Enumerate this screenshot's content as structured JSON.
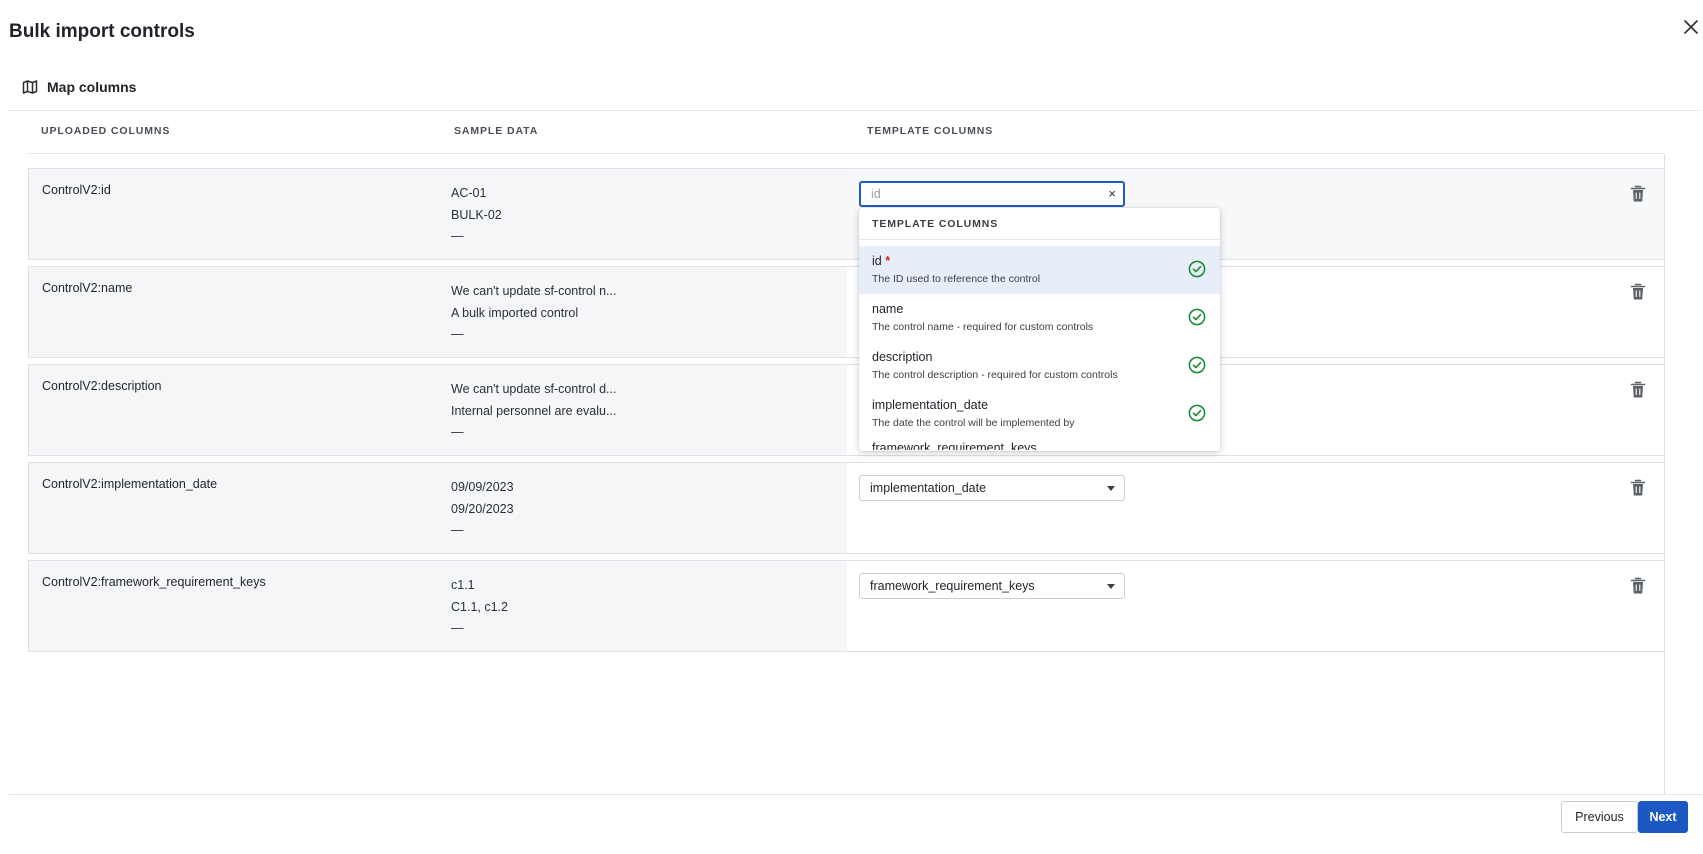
{
  "modal": {
    "title": "Bulk import controls"
  },
  "section": {
    "label": "Map columns"
  },
  "table": {
    "headers": {
      "uploaded": "UPLOADED COLUMNS",
      "sample": "SAMPLE DATA",
      "template": "TEMPLATE COLUMNS"
    },
    "rows": [
      {
        "column": "ControlV2:id",
        "samples": [
          "AC-01",
          "BULK-02",
          "—"
        ],
        "mapping": ""
      },
      {
        "column": "ControlV2:name",
        "samples": [
          "We can't update sf-control n...",
          "A bulk imported control",
          "—"
        ],
        "mapping": ""
      },
      {
        "column": "ControlV2:description",
        "samples": [
          "We can't update sf-control d...",
          "Internal personnel are evalu...",
          "—"
        ],
        "mapping": ""
      },
      {
        "column": "ControlV2:implementation_date",
        "samples": [
          "09/09/2023",
          "09/20/2023",
          "—"
        ],
        "mapping": "implementation_date"
      },
      {
        "column": "ControlV2:framework_requirement_keys",
        "samples": [
          "c1.1",
          "C1.1, c1.2",
          "—"
        ],
        "mapping": "framework_requirement_keys"
      }
    ]
  },
  "combo": {
    "placeholder": "id",
    "clear": "×"
  },
  "dropdown": {
    "header": "TEMPLATE COLUMNS",
    "options": [
      {
        "name": "id",
        "required_mark": "*",
        "description": "The ID used to reference the control",
        "mapped": true
      },
      {
        "name": "name",
        "required_mark": "",
        "description": "The control name - required for custom controls",
        "mapped": true
      },
      {
        "name": "description",
        "required_mark": "",
        "description": "The control description - required for custom controls",
        "mapped": true
      },
      {
        "name": "implementation_date",
        "required_mark": "",
        "description": "The date the control will be implemented by",
        "mapped": true
      },
      {
        "name": "framework_requirement_keys",
        "required_mark": "",
        "description": "",
        "mapped": false
      }
    ]
  },
  "footer": {
    "previous": "Previous",
    "next": "Next"
  },
  "colors": {
    "primary": "#1b58c2",
    "check": "#1f8a3a",
    "required": "#d0282e"
  },
  "icons": {
    "close": "close-icon",
    "map": "map-icon",
    "trash": "trash-icon",
    "check": "check-circle-icon",
    "caret": "caret-down-icon"
  }
}
